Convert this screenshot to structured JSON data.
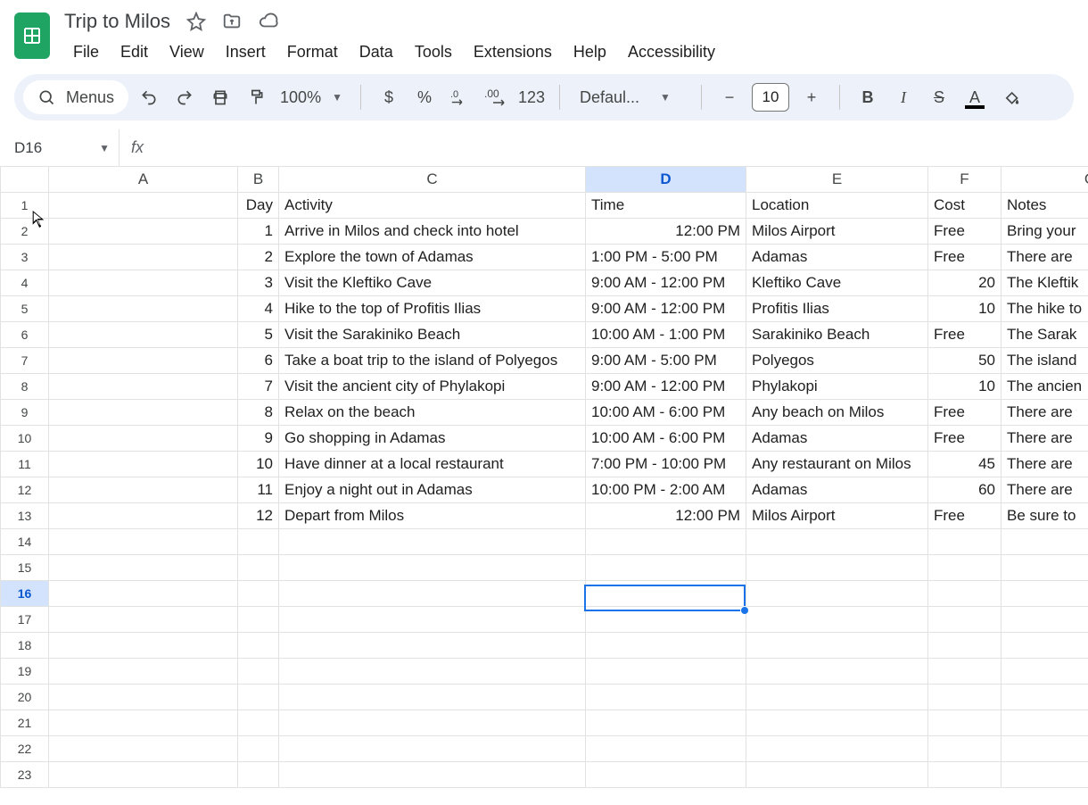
{
  "doc": {
    "title": "Trip to Milos"
  },
  "menubar": [
    "File",
    "Edit",
    "View",
    "Insert",
    "Format",
    "Data",
    "Tools",
    "Extensions",
    "Help",
    "Accessibility"
  ],
  "toolbar": {
    "menus_pill": "Menus",
    "zoom": "100%",
    "font_name": "Defaul...",
    "font_size": "10",
    "number_format": "123"
  },
  "namebox": "D16",
  "formula": "",
  "columns": [
    "A",
    "B",
    "C",
    "D",
    "E",
    "F",
    "G"
  ],
  "selected_column_index": 3,
  "selected_row_index": 15,
  "row_count": 23,
  "headers": {
    "b": "Day",
    "c": "Activity",
    "d": "Time",
    "e": "Location",
    "f": "Cost",
    "g": "Notes"
  },
  "rows": [
    {
      "b": "1",
      "c": "Arrive in Milos and check into hotel",
      "d": "12:00 PM",
      "e": "Milos Airport",
      "f": "Free",
      "g": "Bring your"
    },
    {
      "b": "2",
      "c": "Explore the town of Adamas",
      "d": "1:00 PM - 5:00 PM",
      "e": "Adamas",
      "f": "Free",
      "g": "There are"
    },
    {
      "b": "3",
      "c": "Visit the Kleftiko Cave",
      "d": "9:00 AM - 12:00 PM",
      "e": "Kleftiko Cave",
      "f": "20",
      "g": "The Kleftik"
    },
    {
      "b": "4",
      "c": "Hike to the top of Profitis Ilias",
      "d": "9:00 AM - 12:00 PM",
      "e": "Profitis Ilias",
      "f": "10",
      "g": "The hike to"
    },
    {
      "b": "5",
      "c": "Visit the Sarakiniko Beach",
      "d": "10:00 AM - 1:00 PM",
      "e": "Sarakiniko Beach",
      "f": "Free",
      "g": "The Sarak"
    },
    {
      "b": "6",
      "c": "Take a boat trip to the island of Polyegos",
      "d": "9:00 AM - 5:00 PM",
      "e": "Polyegos",
      "f": "50",
      "g": "The island"
    },
    {
      "b": "7",
      "c": "Visit the ancient city of Phylakopi",
      "d": "9:00 AM - 12:00 PM",
      "e": "Phylakopi",
      "f": "10",
      "g": "The ancien"
    },
    {
      "b": "8",
      "c": "Relax on the beach",
      "d": "10:00 AM - 6:00 PM",
      "e": "Any beach on Milos",
      "f": "Free",
      "g": "There are"
    },
    {
      "b": "9",
      "c": "Go shopping in Adamas",
      "d": "10:00 AM - 6:00 PM",
      "e": "Adamas",
      "f": "Free",
      "g": "There are"
    },
    {
      "b": "10",
      "c": "Have dinner at a local restaurant",
      "d": "7:00 PM - 10:00 PM",
      "e": "Any restaurant on Milos",
      "f": "45",
      "g": "There are"
    },
    {
      "b": "11",
      "c": "Enjoy a night out in Adamas",
      "d": "10:00 PM - 2:00 AM",
      "e": "Adamas",
      "f": "60",
      "g": "There are"
    },
    {
      "b": "12",
      "c": "Depart from Milos",
      "d": "12:00 PM",
      "e": "Milos Airport",
      "f": "Free",
      "g": "Be sure to"
    }
  ]
}
